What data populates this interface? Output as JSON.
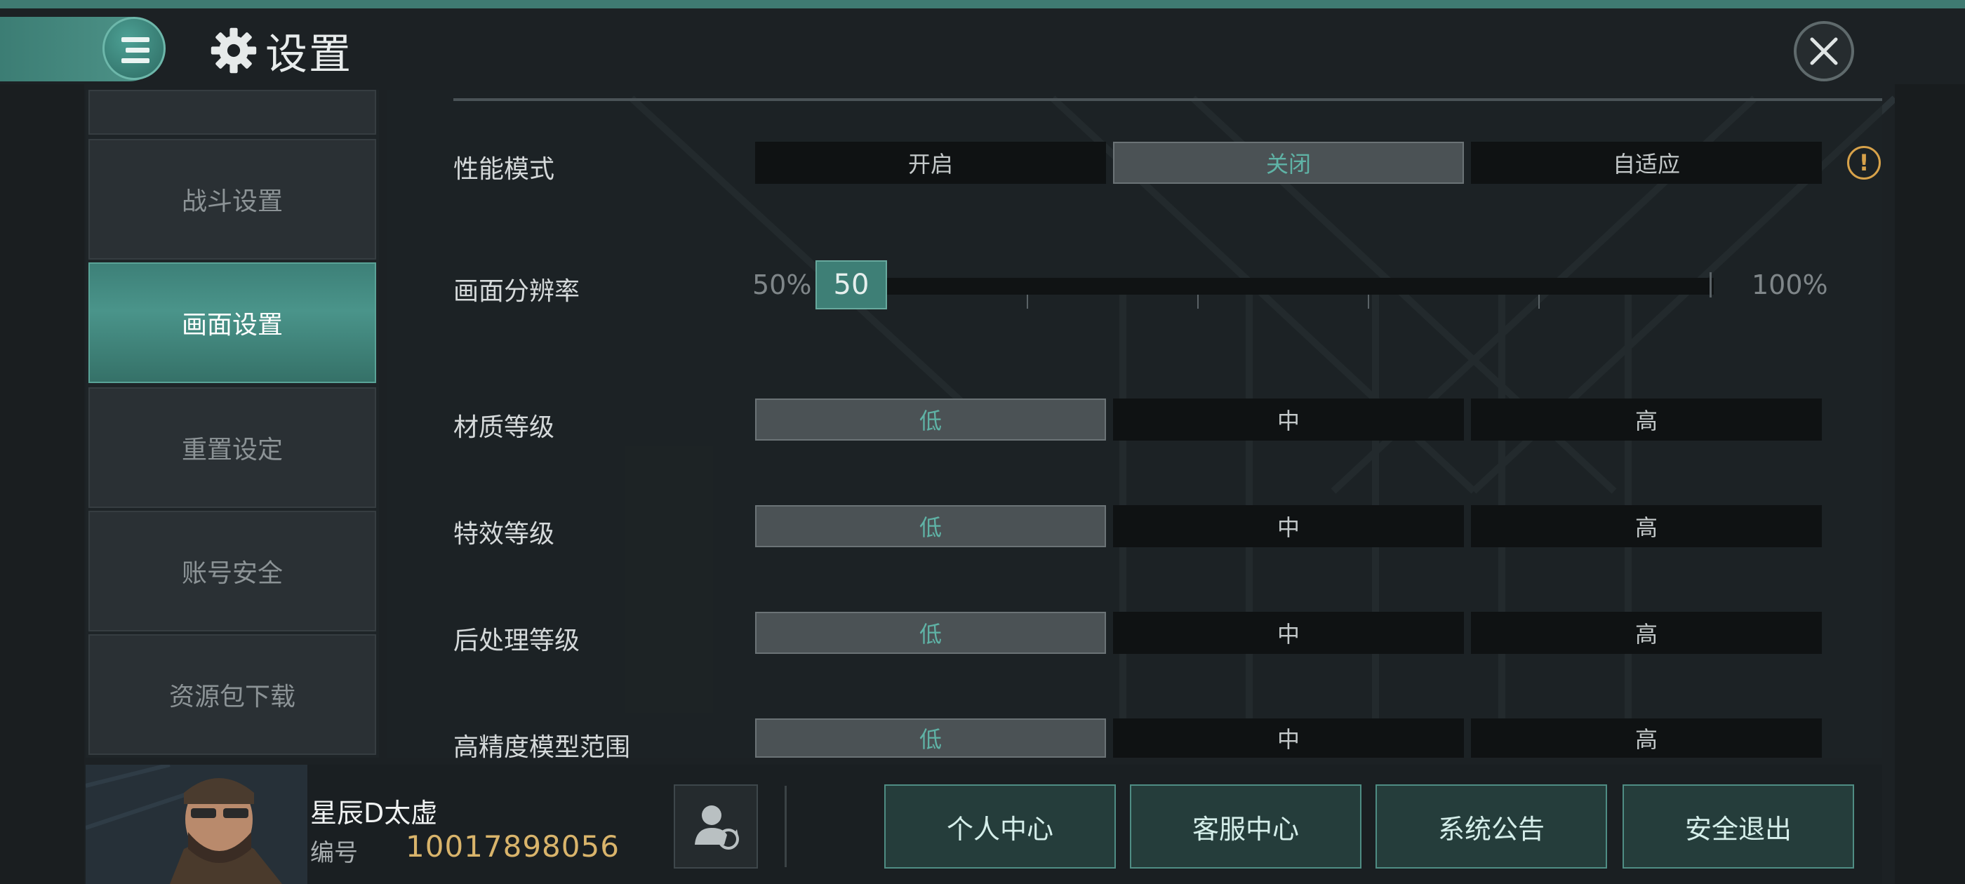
{
  "header": {
    "title": "设置",
    "menu_icon": "menu-icon",
    "settings_icon": "gear-icon",
    "close_icon": "close-icon"
  },
  "sidebar": {
    "items": [
      {
        "label": ""
      },
      {
        "label": "战斗设置"
      },
      {
        "label": "画面设置",
        "active": true
      },
      {
        "label": "重置设定"
      },
      {
        "label": "账号安全"
      },
      {
        "label": "资源包下载"
      }
    ]
  },
  "settings": {
    "performance_mode": {
      "label": "性能模式",
      "options": [
        "开启",
        "关闭",
        "自适应"
      ],
      "selected": "关闭",
      "info_icon": "warning-icon"
    },
    "resolution": {
      "label": "画面分辨率",
      "min_label": "50%",
      "max_label": "100%",
      "value": "50",
      "fraction": 0.0
    },
    "texture_level": {
      "label": "材质等级",
      "options": [
        "低",
        "中",
        "高"
      ],
      "selected": "低"
    },
    "effects_level": {
      "label": "特效等级",
      "options": [
        "低",
        "中",
        "高"
      ],
      "selected": "低"
    },
    "postprocess_level": {
      "label": "后处理等级",
      "options": [
        "低",
        "中",
        "高"
      ],
      "selected": "低"
    },
    "hq_model_range": {
      "label": "高精度模型范围",
      "options": [
        "低",
        "中",
        "高"
      ],
      "selected": "低"
    }
  },
  "footer": {
    "user_name": "星辰D太虚",
    "id_label": "编号",
    "id_value": "10017898056",
    "switch_account_icon": "switch-account-icon",
    "buttons": [
      "个人中心",
      "客服中心",
      "系统公告",
      "安全退出"
    ]
  },
  "colors": {
    "accent": "#4a948a",
    "selected_text": "#5fb3a6",
    "id_gold": "#d9b46b",
    "warning": "#d7a24a"
  }
}
